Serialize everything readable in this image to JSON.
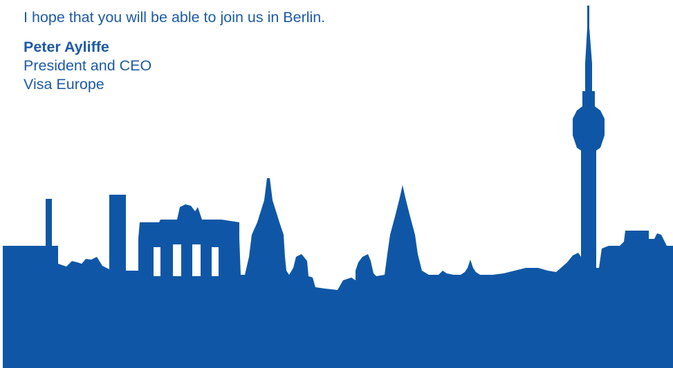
{
  "letter": {
    "closing_line": "I hope that you will be able to join us in Berlin.",
    "signature": {
      "name": "Peter Ayliffe",
      "title": "President and CEO",
      "organization": "Visa Europe"
    }
  },
  "illustration": {
    "subject": "Berlin skyline silhouette",
    "color": "#0f57a6"
  }
}
